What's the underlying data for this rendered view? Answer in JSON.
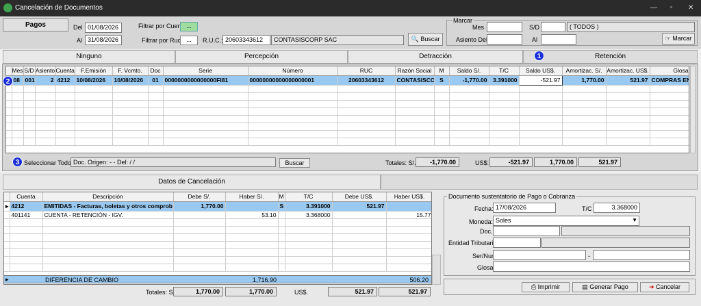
{
  "window": {
    "title": "Cancelación de Documentos",
    "min": "—",
    "max": "▫",
    "close": "✕"
  },
  "filters": {
    "mode_label": "Pagos",
    "del_label": "Del",
    "del_value": "01/08/2026",
    "al_label": "Al",
    "al_value": "31/08/2026",
    "por_cuentas_label": "Filtrar por Cuentas:",
    "por_cuentas_value": "...",
    "por_ruc_label": "Filtrar por Ruc:",
    "por_ruc_value": "...",
    "ruc_label": "R.U.C.:",
    "ruc_value": "20603343612",
    "ruc_name": "CONTASISCORP SAC",
    "buscar_label": "Buscar"
  },
  "marcar": {
    "group_label": "Marcar",
    "mes_label": "Mes",
    "mes_value": "",
    "sd_label": "S/D",
    "sd_value": "",
    "sd_desc": "( TODOS )",
    "asiento_label": "Asiento Del",
    "asiento_value": "",
    "al_label": "Al",
    "al_value": "",
    "button_label": "Marcar"
  },
  "tabs": [
    "Ninguno",
    "Percepción",
    "Detracción",
    "Retención"
  ],
  "badges": [
    "1",
    "2",
    "3"
  ],
  "doc_grid": {
    "columns": [
      "Mes",
      "S/D",
      "Asiento",
      "Cuenta",
      "F.Emisión",
      "F. Vcmto.",
      "Doc",
      "Serie",
      "Número",
      "RUC",
      "Razón Social",
      "M",
      "Saldo S/.",
      "T/C",
      "Saldo US$.",
      "Amortizac. S/.",
      "Amortizac. US$.",
      "Glosa"
    ],
    "rows": [
      [
        "08",
        "001",
        "2",
        "4212",
        "10/08/2026",
        "10/08/2026",
        "01",
        "0000000000000000FI81",
        "00000000000000000001",
        "20603343612",
        "CONTASISCOR",
        "S",
        "-1,770.00",
        "3.391000",
        "-521.97",
        "1,770.00",
        "521.97",
        "COMPRAS ENTRE AGE"
      ]
    ]
  },
  "doc_footer": {
    "select_all": "Seleccionar Todo",
    "doc_origen": "Doc. Origen:  - -  Del:  / /",
    "buscar": "Buscar",
    "totales_label": "Totales:  S/.",
    "total_soles": "-1,770.00",
    "usd_label": "US$:",
    "total_usd": "-521.97",
    "total_amort_soles": "1,770.00",
    "total_amort_usd": "521.97"
  },
  "bottom_tabs": [
    "Datos de Cancelación",
    ""
  ],
  "cancel_grid": {
    "columns": [
      "Cuenta",
      "Descripción",
      "Debe S/.",
      "Haber S/.",
      "M",
      "T/C",
      "Debe US$.",
      "Haber US$."
    ],
    "rows": [
      [
        "4212",
        "EMITIDAS - Facturas, boletas y otros comprob",
        "1,770.00",
        "",
        "S",
        "3.391000",
        "521.97",
        ""
      ],
      [
        "401141",
        "CUENTA - RETENCIÓN - IGV.",
        "",
        "53.10",
        "",
        "3.368000",
        "",
        "15.77"
      ]
    ],
    "diff_label": "DIFERENCIA DE CAMBIO",
    "diff_haber": "1,716.90",
    "diff_haber_usd": "506.20"
  },
  "cancel_totals": {
    "label": "Totales:  S/.",
    "debe": "1,770.00",
    "haber": "1,770.00",
    "usd_label": "US$.",
    "debe_usd": "521.97",
    "haber_usd": "521.97"
  },
  "doc_pago": {
    "group_label": "Documento sustentatorio de Pago o Cobranza",
    "fecha_label": "Fecha:",
    "fecha_value": "17/08/2026",
    "tc_label": "T/C",
    "tc_value": "3.368000",
    "moneda_label": "Moneda:",
    "moneda_value": "Soles",
    "doc_label": "Doc.:",
    "doc_value": "",
    "doc_desc": "",
    "entidad_label": "Entidad Tributaria",
    "entidad_value": "",
    "entidad_desc": "",
    "sernum_label": "Ser/Num",
    "ser_value": "",
    "num_value": "",
    "glosa_label": "Glosa:",
    "glosa_value": ""
  },
  "actions": {
    "imprimir": "Imprimir",
    "generar": "Generar Pago",
    "cancelar": "Cancelar"
  }
}
